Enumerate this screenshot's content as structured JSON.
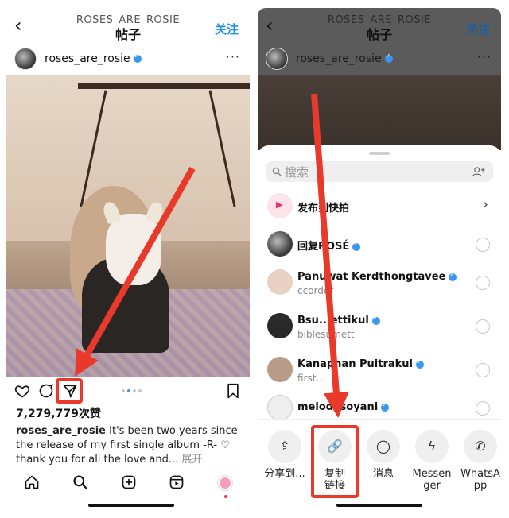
{
  "left": {
    "username_header": "ROSES_ARE_ROSIE",
    "title": "帖子",
    "follow": "关注",
    "back_icon": "‹",
    "username": "roses_are_rosie",
    "more": "···",
    "likes": "7,279,779次赞",
    "caption_user": "roses_are_rosie",
    "caption_text": "It's been two years since the release of my first single album -R- ♡ thank you for all the love and...",
    "caption_more": "展开",
    "icons": {
      "like": "heart-icon",
      "comment": "comment-icon",
      "share": "paper-plane-icon",
      "save": "bookmark-icon"
    },
    "carousel_dots": 4,
    "carousel_active": 1
  },
  "right": {
    "username_header": "ROSES_ARE_ROSIE",
    "title": "帖子",
    "follow": "关注",
    "username": "roses_are_rosie",
    "more": "···",
    "search_placeholder": "搜索",
    "quick": "发布到快拍",
    "contacts": [
      {
        "name": "回复ROSÉ",
        "sub": ""
      },
      {
        "name": "Panuwat Kerdthongtavee",
        "sub": "ccorder"
      },
      {
        "name": "Bsu...ettikul",
        "sub": "biblesumett"
      },
      {
        "name": "Kanaphan Puitrakul",
        "sub": "first..."
      },
      {
        "name": "melodysoyani",
        "sub": ""
      }
    ],
    "share_options": [
      {
        "label": "分享到...",
        "icon": "share-upload-icon"
      },
      {
        "label": "复制\n链接",
        "icon": "link-icon"
      },
      {
        "label": "消息",
        "icon": "message-icon"
      },
      {
        "label": "Messen\nger",
        "icon": "messenger-icon"
      },
      {
        "label": "WhatsA\npp",
        "icon": "whatsapp-icon"
      }
    ]
  },
  "accent_red": "#e8392a",
  "accent_blue": "#1a8ff0"
}
